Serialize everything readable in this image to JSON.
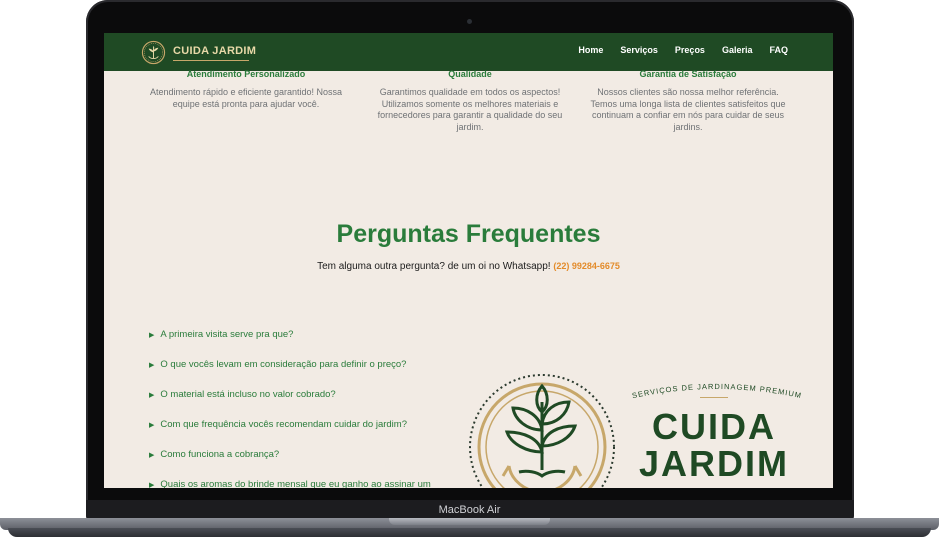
{
  "navbar": {
    "brand": "CUIDA JARDIM",
    "items": [
      "Home",
      "Serviços",
      "Preços",
      "Galeria",
      "FAQ"
    ]
  },
  "features": [
    {
      "title": "Atendimento Personalizado",
      "text": "Atendimento rápido e eficiente garantido! Nossa equipe está pronta para ajudar você."
    },
    {
      "title": "Qualidade",
      "text": "Garantimos qualidade em todos os aspectos! Utilizamos somente os melhores materiais e fornecedores para garantir a qualidade do seu jardim."
    },
    {
      "title": "Garantia de Satisfação",
      "text": "Nossos clientes são nossa melhor referência. Temos uma longa lista de clientes satisfeitos que continuam a confiar em nós para cuidar de seus jardins."
    }
  ],
  "faq": {
    "title": "Perguntas Frequentes",
    "subtitle": "Tem alguma outra pergunta? de um oi no Whatsapp!",
    "phone": "(22) 99284-6675",
    "questions": [
      "A primeira visita serve pra que?",
      "O que vocês levam em consideração para definir o preço?",
      "O material está incluso no valor cobrado?",
      "Com que frequência vocês recomendam cuidar do jardim?",
      "Como funciona a cobrança?",
      "Quais os aromas do brinde mensal que eu ganho ao assinar um"
    ]
  },
  "logo_block": {
    "tagline": "SERVIÇOS DE JARDINAGEM PREMIUM",
    "line1": "CUIDA",
    "line2": "JARDIM"
  },
  "device_label": "MacBook Air",
  "colors": {
    "primary": "#1f4a24",
    "accent": "#2a7c3b",
    "gold": "#c7a76a",
    "orange": "#e38b2a",
    "background": "#f2ebe4"
  }
}
